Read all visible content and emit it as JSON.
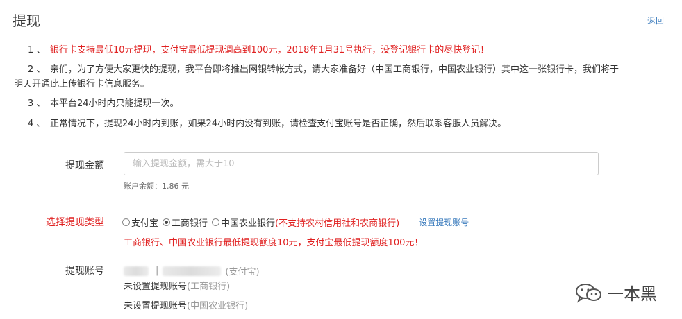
{
  "header": {
    "title": "提现",
    "back_label": "返回"
  },
  "notices": [
    {
      "num": "1 、",
      "text": "银行卡支持最低10元提现，支付宝最低提现调高到100元，2018年1月31号执行，没登记银行卡的尽快登记！"
    },
    {
      "num": "2 、",
      "text": "亲们，为了方便大家更快的提现，我平台即将推出网银转帐方式，请大家准备好（中国工商银行，中国农业银行）其中这一张银行卡，我们将于",
      "text2": "明天开通此上传银行卡信息服务。"
    },
    {
      "num": "3 、",
      "text": "本平台24小时内只能提现一次。"
    },
    {
      "num": "4 、",
      "text": "正常情况下，提现24小时内到账，如果24小时内没有到账，请检查支付宝账号是否正确，然后联系客服人员解决。"
    }
  ],
  "form": {
    "amount_label": "提现金额",
    "amount_placeholder": "输入提现金额，需大于10",
    "amount_value": "",
    "balance": "账户余额：1.86 元",
    "type_label": "选择提现类型",
    "types": [
      {
        "label": "支付宝",
        "checked": false
      },
      {
        "label": "工商银行",
        "checked": true
      },
      {
        "label": "中国农业银行",
        "checked": false
      }
    ],
    "type_hint": "(不支持农村信用社和农商银行)",
    "set_account_label": "设置提现账号",
    "type_warning": "工商银行、中国农业银行最低提现额度10元，支付宝最低提现额度100元！",
    "account_label": "提现账号",
    "accounts": [
      {
        "sep": "|",
        "suffix": "(支付宝)"
      },
      {
        "prefix": "未设置提现账号",
        "suffix": "(工商银行)"
      },
      {
        "prefix": "未设置提现账号",
        "suffix": "(中国农业银行)"
      }
    ]
  },
  "watermark": {
    "text": "一本黑",
    "icon": "wechat-icon"
  },
  "colors": {
    "red": "#e02020",
    "link": "#3a7bbd",
    "text": "#333333"
  }
}
